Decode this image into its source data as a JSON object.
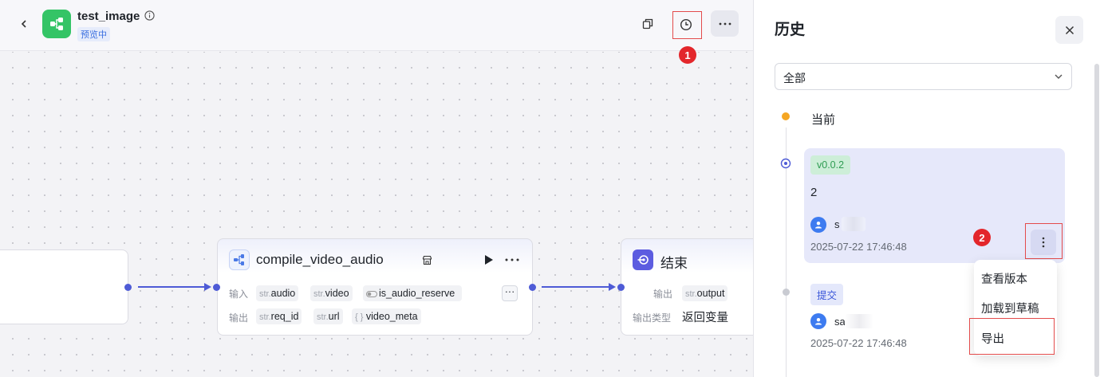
{
  "header": {
    "app_title": "test_image",
    "status_badge": "预览中"
  },
  "annotations": {
    "step1": "1",
    "step2": "2"
  },
  "canvas": {
    "nodes": {
      "compile": {
        "title": "compile_video_audio",
        "input_label": "输入",
        "output_label": "输出",
        "inputs": [
          {
            "type": "str.",
            "name": "audio"
          },
          {
            "type": "str.",
            "name": "video"
          },
          {
            "type": "",
            "name": "is_audio_reserve"
          }
        ],
        "outputs": [
          {
            "type": "str.",
            "name": "req_id"
          },
          {
            "type": "str.",
            "name": "url"
          },
          {
            "type": "{ }",
            "name": "video_meta"
          }
        ],
        "more": "···"
      },
      "end": {
        "title": "结束",
        "output_label": "输出",
        "output_type_label": "输出类型",
        "output": {
          "type": "str.",
          "name": "output"
        },
        "output_type_value": "返回变量"
      }
    }
  },
  "history_panel": {
    "title": "历史",
    "filter_value": "全部",
    "current_label": "当前",
    "entries": [
      {
        "tag": "v0.0.2",
        "description": "2",
        "author_initial": "s",
        "timestamp": "2025-07-22 17:46:48"
      },
      {
        "tag": "提交",
        "author_initial": "sa",
        "timestamp": "2025-07-22 17:46:48"
      }
    ],
    "menu": [
      "查看版本",
      "加载到草稿",
      "导出"
    ],
    "colors": {
      "accent": "#4e5bd6",
      "current_dot": "#f5a623",
      "highlight": "#e34b4b"
    }
  }
}
